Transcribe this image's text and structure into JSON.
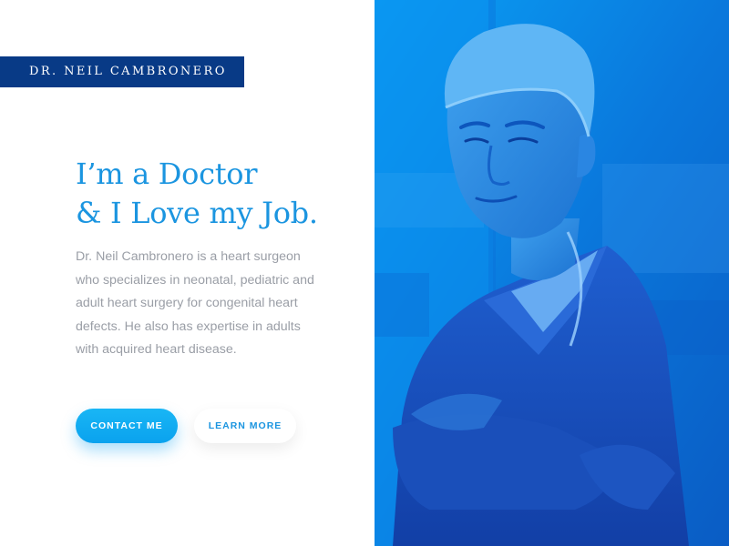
{
  "header": {
    "name_tag": "DR. NEIL CAMBRONERO"
  },
  "hero": {
    "headline_line1": "I’m a Doctor",
    "headline_line2": "& I Love my Job.",
    "description": "Dr. Neil Cambronero is a heart surgeon who specializes in neonatal, pediatric and adult heart surgery for congenital heart defects. He also has expertise in adults with acquired heart disease."
  },
  "actions": {
    "contact_label": "CONTACT ME",
    "learn_label": "LEARN MORE"
  },
  "colors": {
    "brand_dark": "#083a86",
    "accent": "#1b95e0",
    "button_gradient_top": "#19b6f5",
    "photo_overlay": "#0a6fd8"
  },
  "photo": {
    "subject": "surgeon-portrait"
  }
}
